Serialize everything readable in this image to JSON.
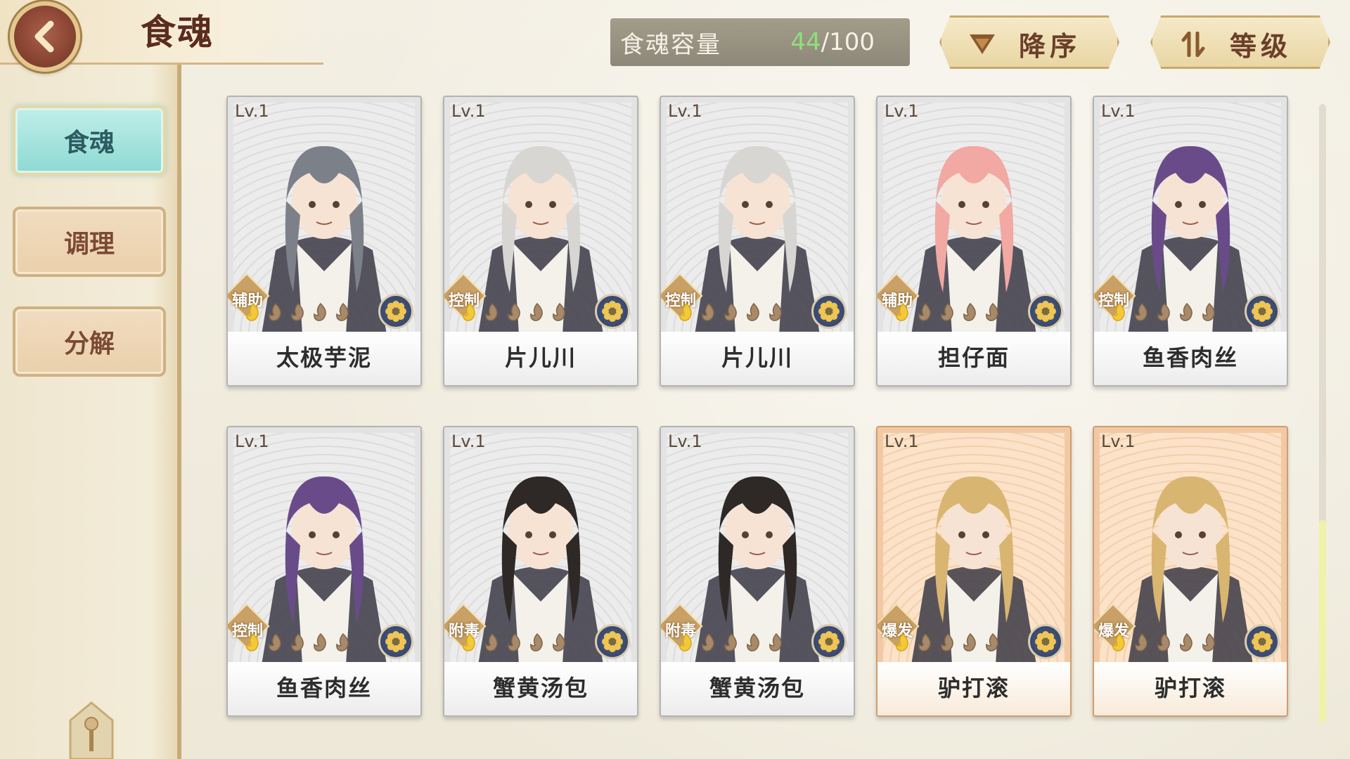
{
  "header": {
    "title": "食魂",
    "back_icon": "back-arrow-icon"
  },
  "sidebar": {
    "items": [
      {
        "label": "食魂",
        "active": true
      },
      {
        "label": "调理",
        "active": false
      },
      {
        "label": "分解",
        "active": false
      }
    ]
  },
  "capacity": {
    "label": "食魂容量",
    "current": "44",
    "max": "/100",
    "current_color": "#8ee07a"
  },
  "sort": {
    "order_label": "降序",
    "order_icon": "descending-icon",
    "field_label": "等级",
    "field_icon": "sort-swap-icon"
  },
  "cards": [
    {
      "level": "Lv.1",
      "role": "辅助",
      "name": "太极芋泥",
      "stars": 1,
      "rarity": "normal",
      "hair": "#7c8088"
    },
    {
      "level": "Lv.1",
      "role": "控制",
      "name": "片儿川",
      "stars": 1,
      "rarity": "normal",
      "hair": "#d8d6d2"
    },
    {
      "level": "Lv.1",
      "role": "控制",
      "name": "片儿川",
      "stars": 1,
      "rarity": "normal",
      "hair": "#d8d6d2"
    },
    {
      "level": "Lv.1",
      "role": "辅助",
      "name": "担仔面",
      "stars": 1,
      "rarity": "normal",
      "hair": "#f2a8a3"
    },
    {
      "level": "Lv.1",
      "role": "控制",
      "name": "鱼香肉丝",
      "stars": 1,
      "rarity": "normal",
      "hair": "#6a4b8a"
    },
    {
      "level": "Lv.1",
      "role": "控制",
      "name": "鱼香肉丝",
      "stars": 1,
      "rarity": "normal",
      "hair": "#6a4b8a"
    },
    {
      "level": "Lv.1",
      "role": "附毒",
      "name": "蟹黄汤包",
      "stars": 1,
      "rarity": "normal",
      "hair": "#2e2826"
    },
    {
      "level": "Lv.1",
      "role": "附毒",
      "name": "蟹黄汤包",
      "stars": 1,
      "rarity": "normal",
      "hair": "#2e2826"
    },
    {
      "level": "Lv.1",
      "role": "爆发",
      "name": "驴打滚",
      "stars": 1,
      "rarity": "gold",
      "hair": "#d8b571"
    },
    {
      "level": "Lv.1",
      "role": "爆发",
      "name": "驴打滚",
      "stars": 1,
      "rarity": "gold",
      "hair": "#d8b571"
    }
  ],
  "colors": {
    "accent_teal": "#8fd9d3",
    "brand_brown": "#5a2c1f",
    "gold_frame": "#c7a968"
  },
  "scroll": {
    "position": 0.67
  }
}
